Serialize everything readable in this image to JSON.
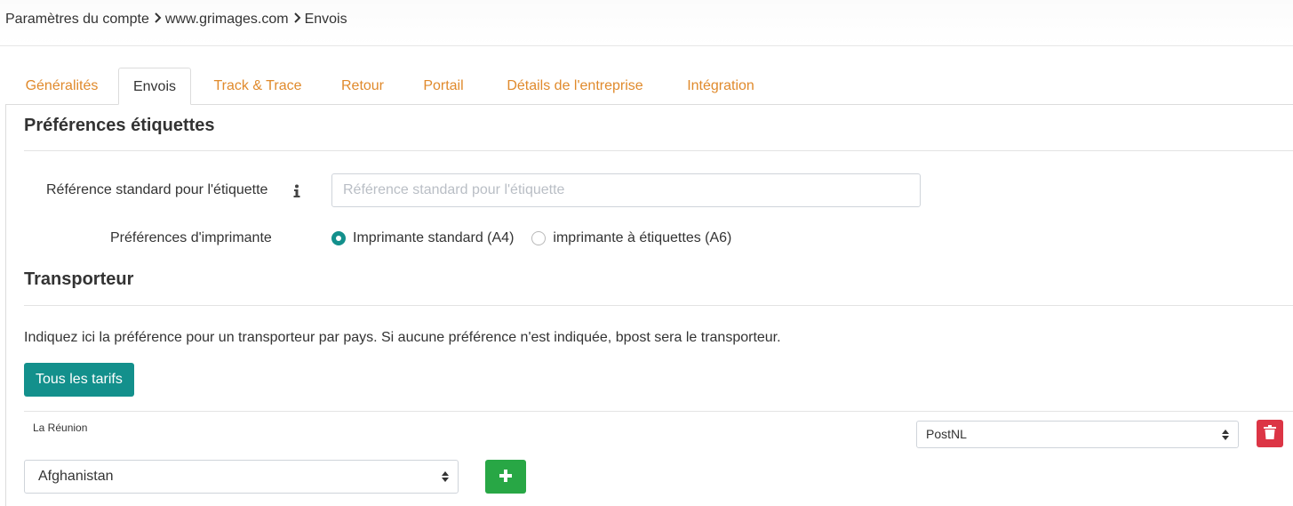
{
  "breadcrumb": {
    "items": [
      "Paramètres du compte",
      "www.grimages.com",
      "Envois"
    ]
  },
  "tabs": [
    {
      "label": "Généralités",
      "active": false
    },
    {
      "label": "Envois",
      "active": true
    },
    {
      "label": "Track & Trace",
      "active": false
    },
    {
      "label": "Retour",
      "active": false
    },
    {
      "label": "Portail",
      "active": false
    },
    {
      "label": "Détails de l'entreprise",
      "active": false
    },
    {
      "label": "Intégration",
      "active": false
    }
  ],
  "labels_section": {
    "title": "Préférences étiquettes",
    "reference_label": "Référence standard pour l'étiquette",
    "reference_placeholder": "Référence standard pour l'étiquette",
    "reference_value": "",
    "printer_label": "Préférences d'imprimante",
    "printer_options": [
      {
        "label": "Imprimante standard (A4)",
        "checked": true
      },
      {
        "label": "imprimante à étiquettes (A6)",
        "checked": false
      }
    ]
  },
  "carrier_section": {
    "title": "Transporteur",
    "description": "Indiquez ici la préférence pour un transporteur par pays. Si aucune préférence n'est indiquée, bpost sera le transporteur.",
    "all_rates_button": "Tous les tarifs",
    "rows": [
      {
        "country": "La Réunion",
        "carrier": "PostNL"
      }
    ],
    "new_country_value": "Afghanistan"
  },
  "colors": {
    "accent_teal": "#13908c",
    "tab_orange": "#e08a2c",
    "danger_red": "#dc3545",
    "success_green": "#28a745"
  },
  "icons": {
    "breadcrumb_separator": "chevron-right-icon",
    "reference_info": "info-icon",
    "delete": "trash-icon",
    "add": "plus-icon",
    "select_caret": "sort-caret-icon"
  }
}
